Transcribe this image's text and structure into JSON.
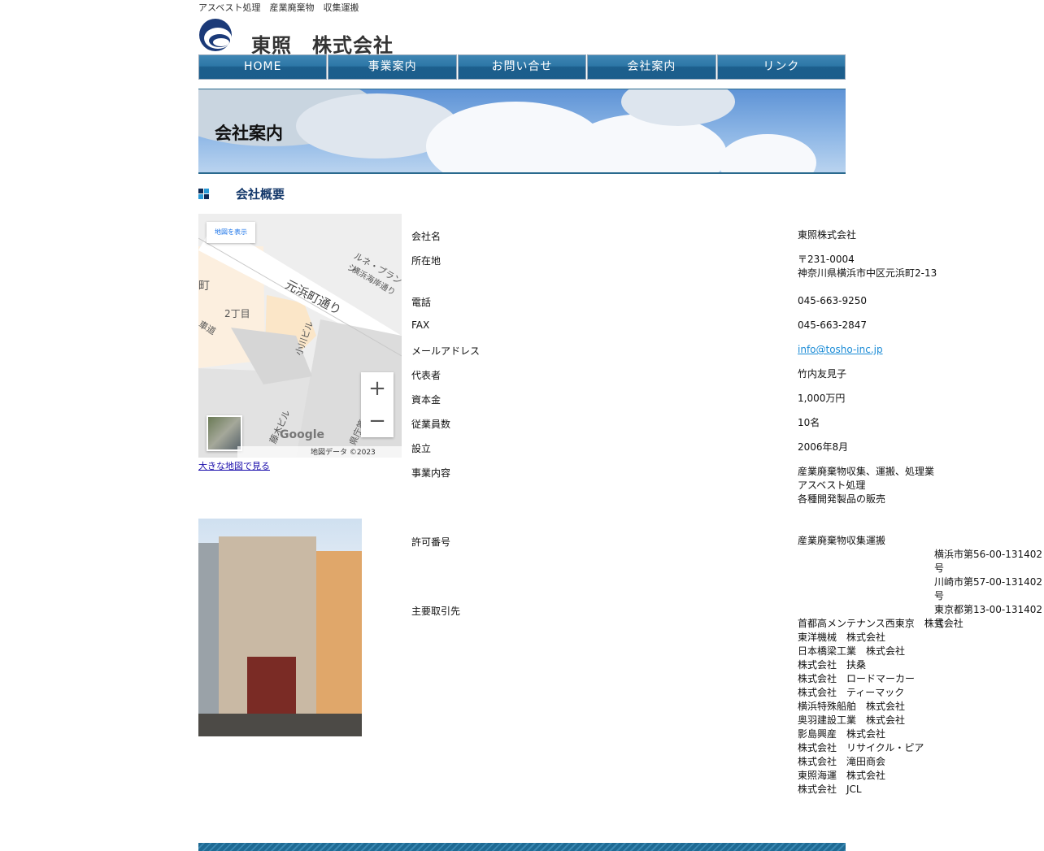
{
  "header": {
    "tagline": "アスベスト処理　産業廃棄物　収集運搬",
    "company_name": "東照　株式会社"
  },
  "nav": {
    "items": [
      "HOME",
      "事業案内",
      "お問い合せ",
      "会社案内",
      "リンク"
    ]
  },
  "hero": {
    "title": "会社案内"
  },
  "section": {
    "title": "会社概要"
  },
  "map": {
    "top_button": "地図を表示",
    "labels": [
      "元浜町通り",
      "2丁目",
      "小川ビル",
      "ルネ・ブランシ",
      "横浜海岸通り",
      "町",
      "車道",
      "藤木ビル",
      "県庁第二"
    ],
    "google": "Google",
    "attribution": "地図データ ©2023",
    "link_text": "大きな地図で見る"
  },
  "company": {
    "name_label": "会社名",
    "name_value": "東照株式会社",
    "address_label": "所在地",
    "postal": "〒231-0004",
    "address": "神奈川県横浜市中区元浜町2‐13",
    "tel_label": "電話",
    "tel_value": "045-663-9250",
    "fax_label": "FAX",
    "fax_value": "045-663-2847",
    "mail_label": "メールアドレス",
    "mail_value": "info@tosho-inc.jp",
    "rep_label": "代表者",
    "rep_value": "竹内友見子",
    "capital_label": "資本金",
    "capital_value": "1,000万円",
    "staff_label": "従業員数",
    "staff_value": "10名",
    "founded_label": "設立",
    "founded_value": "2006年8月",
    "business_label": "事業内容",
    "business_values": [
      "産業廃棄物収集、運搬、処理業",
      "アスベスト処理",
      "各種開発製品の販売"
    ],
    "permit_label": "許可番号",
    "permit_title": "産業廃棄物収集運搬",
    "permit_values": [
      "横浜市第56-00-131402号",
      "川崎市第57-00-131402号",
      "東京都第13-00-131402号"
    ],
    "clients_label": "主要取引先",
    "clients": [
      "首都高メンテナンス西東京　株式会社",
      "東洋機械　株式会社",
      "日本橋梁工業　株式会社",
      "株式会社　扶桑",
      "株式会社　ロードマーカー",
      "株式会社　ティーマック",
      "横浜特殊船舶　株式会社",
      "奥羽建設工業　株式会社",
      "影島興産　株式会社",
      "株式会社　リサイクル・ピア",
      "株式会社　滝田商会",
      "東照海運　株式会社",
      "株式会社　JCL"
    ]
  },
  "colors": {
    "nav": "#1f6a93",
    "accent": "#14386a",
    "link": "#1a8bd6"
  }
}
